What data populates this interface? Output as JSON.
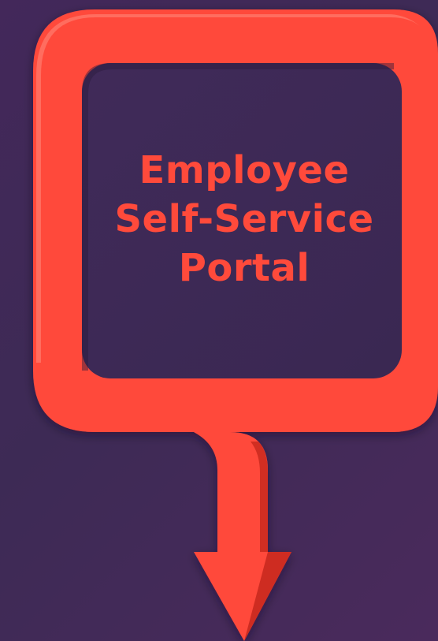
{
  "title": {
    "line1": "Employee",
    "line2": "Self-Service",
    "line3": "Portal"
  },
  "colors": {
    "background_start": "#43285a",
    "background_end": "#4a2a5c",
    "arrow": "#ff4a3b",
    "arrow_shadow": "#b91e14",
    "inner_panel": "#3c2a55",
    "title_text": "#ff4a3b"
  }
}
